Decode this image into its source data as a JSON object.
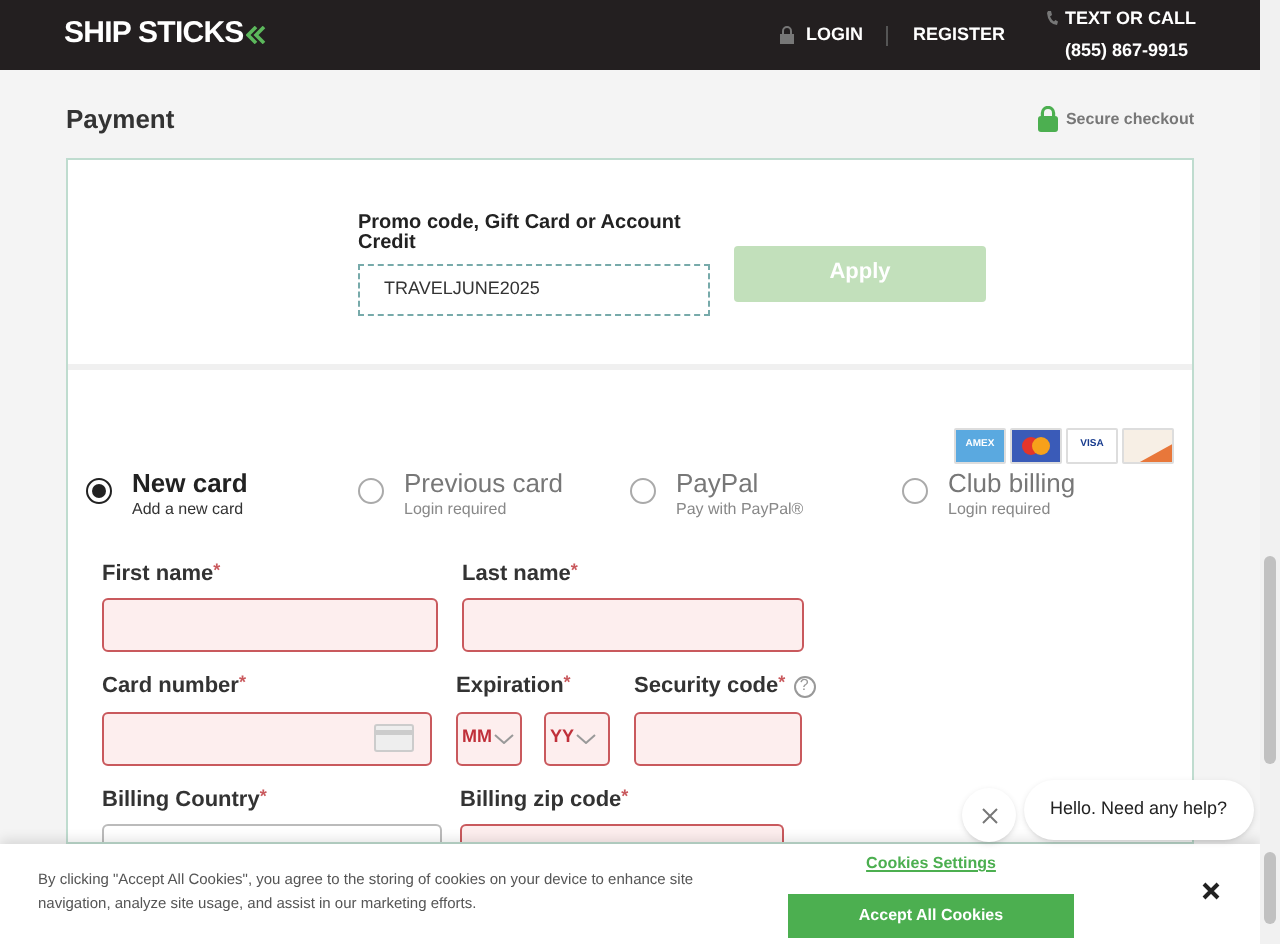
{
  "header": {
    "logo": "SHIP STICKS",
    "nav": [
      {
        "label": "LOGIN",
        "kind": "lock"
      },
      {
        "label": "REGISTER",
        "kind": "plain"
      }
    ],
    "contact": {
      "label": "TEXT OR CALL",
      "phone": "(855) 867-9915"
    }
  },
  "page": {
    "title": "Payment",
    "secure": "Secure checkout"
  },
  "promo": {
    "label": "Promo code, Gift Card or Account Credit",
    "value": "TRAVELJUNE2025",
    "button": "Apply",
    "button_disabled": true
  },
  "card_logos": [
    {
      "kind": "amex",
      "text": "AMEX"
    },
    {
      "kind": "mastercard"
    },
    {
      "kind": "visa",
      "text": "VISA"
    },
    {
      "kind": "discover"
    }
  ],
  "methods": [
    {
      "title": "New card",
      "subtitle": "Add a new card",
      "selected": true
    },
    {
      "title": "Previous card",
      "subtitle": "Login required",
      "selected": false
    },
    {
      "title": "PayPal",
      "subtitle": "Pay with PayPal®",
      "selected": false
    },
    {
      "title": "Club billing",
      "subtitle": "Login required",
      "selected": false
    }
  ],
  "fields": {
    "first_name": {
      "label": "First name",
      "required": "*",
      "invalid": true
    },
    "last_name": {
      "label": "Last name",
      "required": "*",
      "invalid": true
    },
    "card_number": {
      "label": "Card number",
      "required": "*",
      "invalid": true
    },
    "expiration": {
      "label": "Expiration",
      "required": "*",
      "month": "MM",
      "year": "YY",
      "invalid": true
    },
    "security_code": {
      "label": "Security code",
      "required": "*",
      "help": "?",
      "invalid": true
    },
    "billing_country": {
      "label": "Billing Country",
      "required": "*"
    },
    "billing_zip": {
      "label": "Billing zip code",
      "required": "*",
      "invalid": true
    }
  },
  "chat": {
    "message": "Hello. Need any help?"
  },
  "cookies": {
    "text": "By clicking \"Accept All Cookies\", you agree to the storing of cookies on your device to enhance site navigation, analyze site usage, and assist in our marketing efforts.",
    "settings": "Cookies Settings",
    "accept": "Accept All Cookies"
  }
}
